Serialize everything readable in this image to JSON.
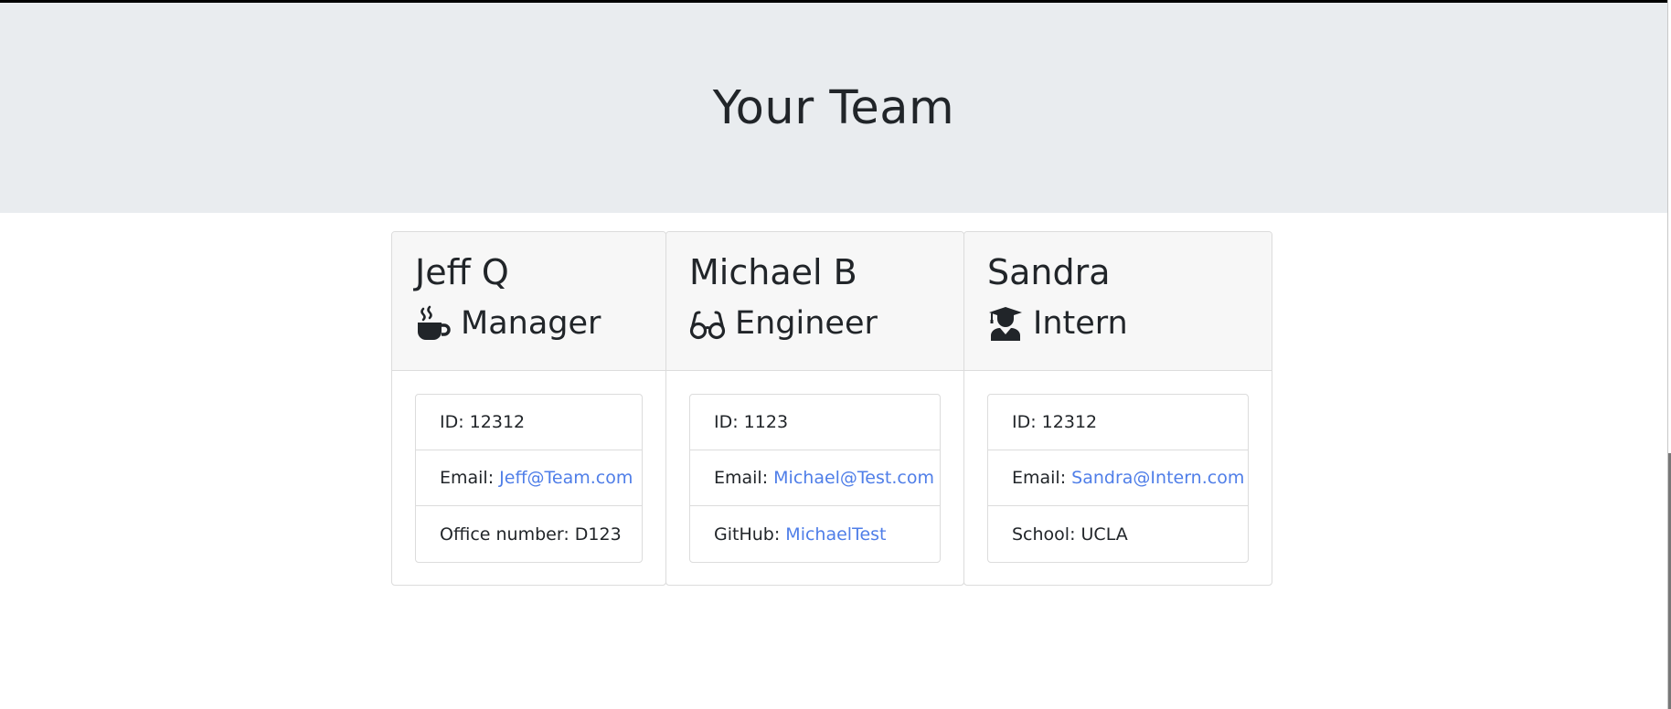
{
  "page": {
    "title": "Your Team"
  },
  "members": [
    {
      "name": "Jeff Q",
      "role": "Manager",
      "icon": "coffee-mug-icon",
      "id_label": "ID: 12312",
      "email_label": "Email: ",
      "email": "Jeff@Team.com",
      "extra_label": "Office number: D123",
      "extra_link": null
    },
    {
      "name": "Michael B",
      "role": "Engineer",
      "icon": "glasses-icon",
      "id_label": "ID: 1123",
      "email_label": "Email: ",
      "email": "Michael@Test.com",
      "extra_label": "GitHub: ",
      "extra_link": "MichaelTest"
    },
    {
      "name": "Sandra",
      "role": "Intern",
      "icon": "graduate-icon",
      "id_label": "ID: 12312",
      "email_label": "Email: ",
      "email": "Sandra@Intern.com",
      "extra_label": "School: UCLA",
      "extra_link": null
    }
  ],
  "colors": {
    "header_bg": "#e9ecef",
    "link": "#4f7ee8",
    "card_header_bg": "#f7f7f7"
  }
}
